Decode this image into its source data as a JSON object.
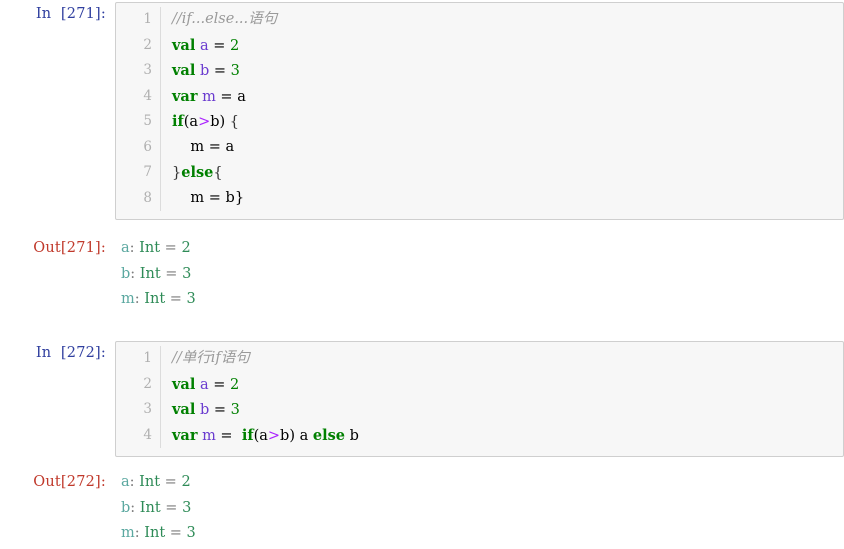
{
  "notebook": {
    "cells": [
      {
        "id": "cell-271",
        "input_prompt": "In  [271]:",
        "output_prompt": "Out[271]:",
        "line_numbers": [
          "1",
          "2",
          "3",
          "4",
          "5",
          "6",
          "7",
          "8"
        ],
        "source_lines": [
          "//if...else...语句",
          "val a = 2",
          "val b = 3",
          "var m = a",
          "if(a>b) {",
          "    m = a",
          "}else{",
          "    m = b}"
        ],
        "tokens": [
          [
            {
              "t": "//if...else...语句",
              "c": "t-comment"
            }
          ],
          [
            {
              "t": "val",
              "c": "t-kw"
            },
            {
              "t": " ",
              "c": "t-plain"
            },
            {
              "t": "a",
              "c": "t-decl"
            },
            {
              "t": " = ",
              "c": "t-plain"
            },
            {
              "t": "2",
              "c": "t-num"
            }
          ],
          [
            {
              "t": "val",
              "c": "t-kw"
            },
            {
              "t": " ",
              "c": "t-plain"
            },
            {
              "t": "b",
              "c": "t-decl"
            },
            {
              "t": " = ",
              "c": "t-plain"
            },
            {
              "t": "3",
              "c": "t-num"
            }
          ],
          [
            {
              "t": "var",
              "c": "t-kw"
            },
            {
              "t": " ",
              "c": "t-plain"
            },
            {
              "t": "m",
              "c": "t-decl"
            },
            {
              "t": " = a",
              "c": "t-plain"
            }
          ],
          [
            {
              "t": "if",
              "c": "t-kw"
            },
            {
              "t": "(a",
              "c": "t-plain"
            },
            {
              "t": ">",
              "c": "t-op"
            },
            {
              "t": "b)",
              "c": "t-plain"
            },
            {
              "t": " {",
              "c": "t-punct"
            }
          ],
          [
            {
              "t": "    m = a",
              "c": "t-plain"
            }
          ],
          [
            {
              "t": "}",
              "c": "t-punct"
            },
            {
              "t": "else",
              "c": "t-kw"
            },
            {
              "t": "{",
              "c": "t-punct"
            }
          ],
          [
            {
              "t": "    m = b}",
              "c": "t-plain"
            }
          ]
        ],
        "output_lines": [
          {
            "name": "a",
            "sep": ": ",
            "type": "Int",
            "eq": " = ",
            "value": "2"
          },
          {
            "name": "b",
            "sep": ": ",
            "type": "Int",
            "eq": " = ",
            "value": "3"
          },
          {
            "name": "m",
            "sep": ": ",
            "type": "Int",
            "eq": " = ",
            "value": "3"
          }
        ]
      },
      {
        "id": "cell-272",
        "input_prompt": "In  [272]:",
        "output_prompt": "Out[272]:",
        "line_numbers": [
          "1",
          "2",
          "3",
          "4"
        ],
        "source_lines": [
          "//单行if语句",
          "val a = 2",
          "val b = 3",
          "var m =  if(a>b) a else b"
        ],
        "tokens": [
          [
            {
              "t": "//单行if语句",
              "c": "t-comment"
            }
          ],
          [
            {
              "t": "val",
              "c": "t-kw"
            },
            {
              "t": " ",
              "c": "t-plain"
            },
            {
              "t": "a",
              "c": "t-decl"
            },
            {
              "t": " = ",
              "c": "t-plain"
            },
            {
              "t": "2",
              "c": "t-num"
            }
          ],
          [
            {
              "t": "val",
              "c": "t-kw"
            },
            {
              "t": " ",
              "c": "t-plain"
            },
            {
              "t": "b",
              "c": "t-decl"
            },
            {
              "t": " = ",
              "c": "t-plain"
            },
            {
              "t": "3",
              "c": "t-num"
            }
          ],
          [
            {
              "t": "var",
              "c": "t-kw"
            },
            {
              "t": " ",
              "c": "t-plain"
            },
            {
              "t": "m",
              "c": "t-decl"
            },
            {
              "t": " =  ",
              "c": "t-plain"
            },
            {
              "t": "if",
              "c": "t-kw"
            },
            {
              "t": "(a",
              "c": "t-plain"
            },
            {
              "t": ">",
              "c": "t-op"
            },
            {
              "t": "b) a ",
              "c": "t-plain"
            },
            {
              "t": "else",
              "c": "t-kw"
            },
            {
              "t": " b",
              "c": "t-plain"
            }
          ]
        ],
        "output_lines": [
          {
            "name": "a",
            "sep": ": ",
            "type": "Int",
            "eq": " = ",
            "value": "2"
          },
          {
            "name": "b",
            "sep": ": ",
            "type": "Int",
            "eq": " = ",
            "value": "3"
          },
          {
            "name": "m",
            "sep": ": ",
            "type": "Int",
            "eq": " = ",
            "value": "3"
          }
        ]
      }
    ]
  },
  "colors": {
    "in_prompt": "#303F9F",
    "out_prompt": "#C0392B",
    "keyword": "#008000",
    "declaration": "#6A3BCF",
    "comment": "#9a9a9a",
    "operator": "#AA22FF",
    "output_name": "#5BA8A0",
    "output_type": "#2E8B57",
    "cell_background": "#f7f7f7",
    "cell_border": "#cfcfcf"
  }
}
